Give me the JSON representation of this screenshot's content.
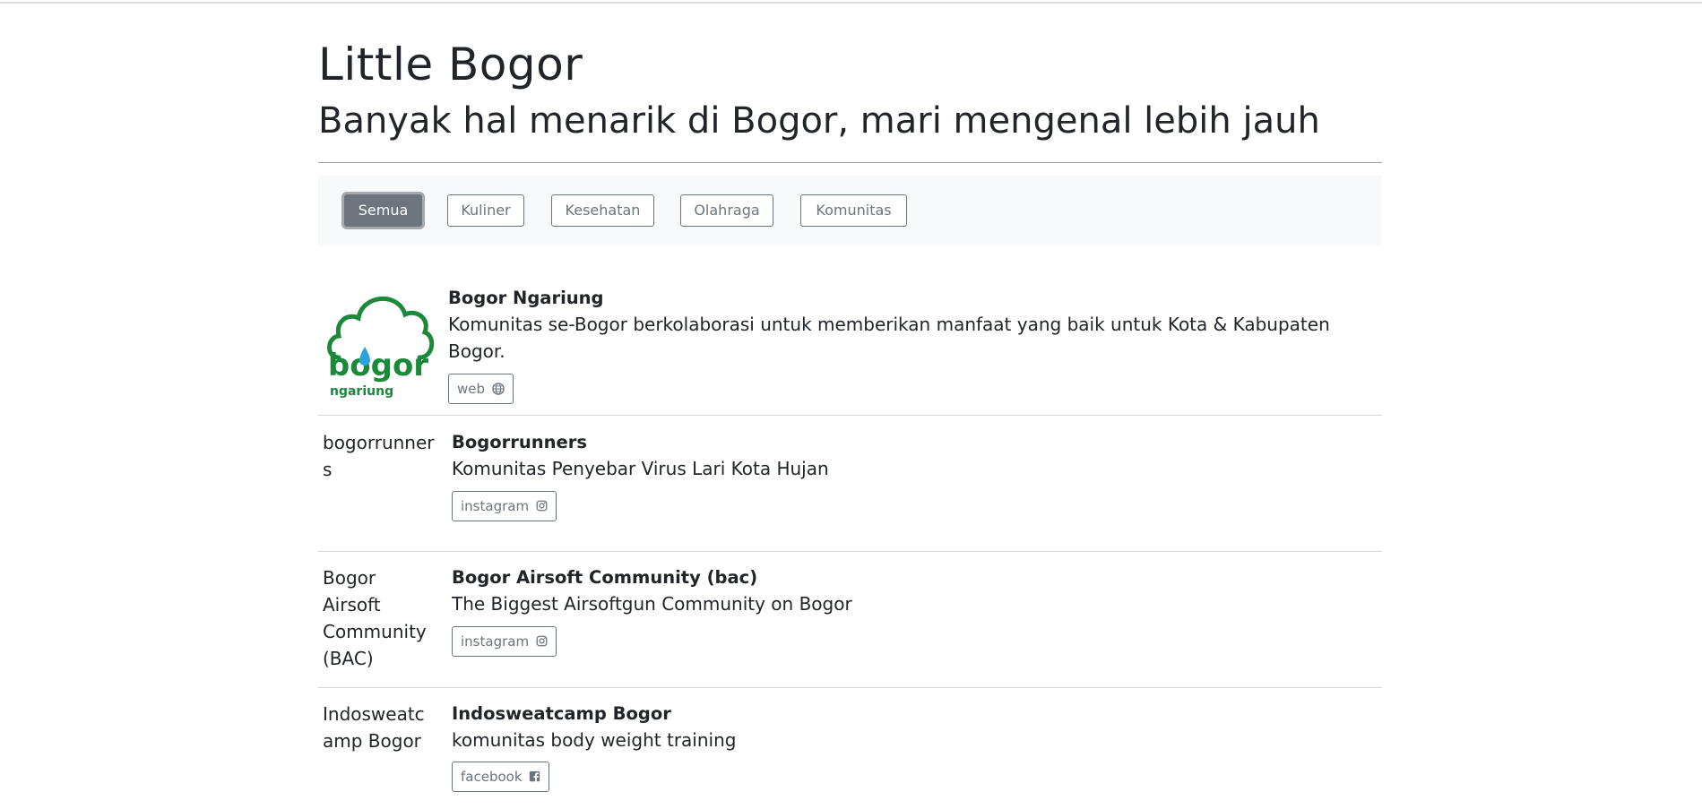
{
  "header": {
    "title": "Little Bogor",
    "subtitle": "Banyak hal menarik di Bogor, mari mengenal lebih jauh"
  },
  "filters": [
    {
      "label": "Semua",
      "active": true
    },
    {
      "label": "Kuliner",
      "active": false
    },
    {
      "label": "Kesehatan",
      "active": false
    },
    {
      "label": "Olahraga",
      "active": false
    },
    {
      "label": "Komunitas",
      "active": false
    }
  ],
  "logo": {
    "brand_text": "bogor",
    "sub_text": "ngariung",
    "color": "#1a8a3a",
    "drop_color": "#29a3dc"
  },
  "items": [
    {
      "name": "Bogor Ngariung",
      "description": "Komunitas se-Bogor berkolaborasi untuk memberikan manfaat yang baik untuk Kota & Kabupaten Bogor.",
      "link_label": "web",
      "link_icon": "globe-icon"
    },
    {
      "image_alt": "bogorrunners",
      "name": "Bogorrunners",
      "description": "Komunitas Penyebar Virus Lari Kota Hujan",
      "link_label": "instagram",
      "link_icon": "instagram-icon"
    },
    {
      "image_alt": "Bogor Airsoft Community (BAC)",
      "name": "Bogor Airsoft Community (bac)",
      "description": "The Biggest Airsoftgun Community on Bogor",
      "link_label": "instagram",
      "link_icon": "instagram-icon"
    },
    {
      "image_alt": "Indosweatcamp Bogor",
      "name": "Indosweatcamp Bogor",
      "description": "komunitas body weight training",
      "link_label": "facebook",
      "link_icon": "facebook-icon"
    }
  ]
}
